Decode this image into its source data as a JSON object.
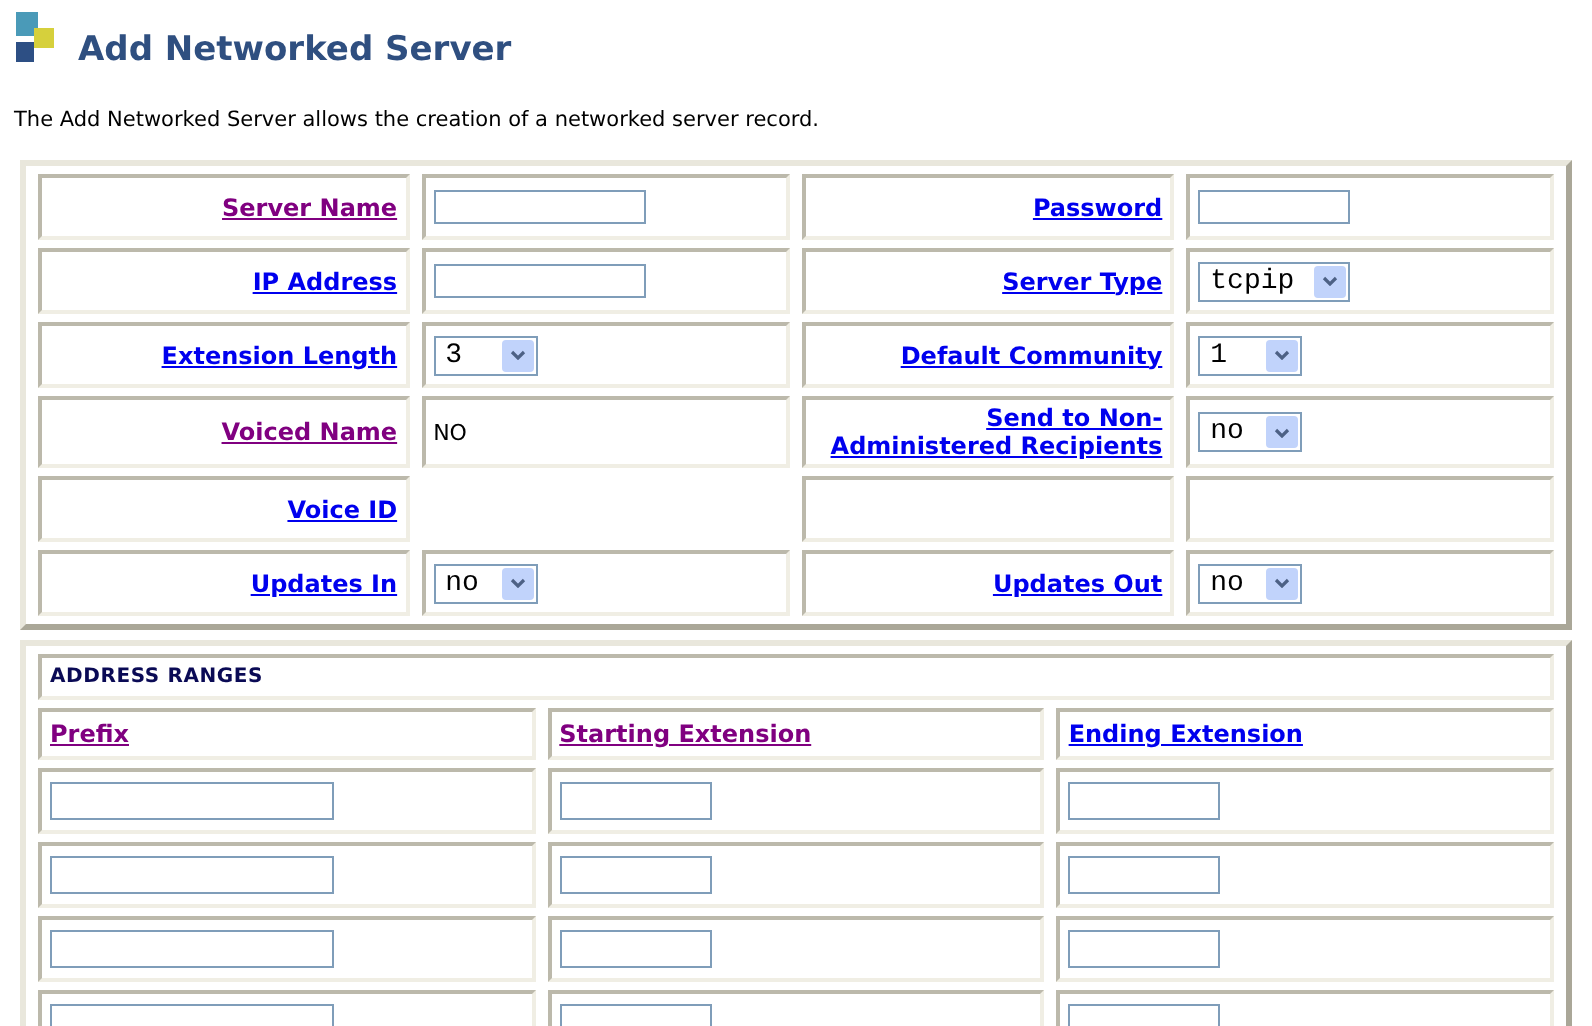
{
  "page": {
    "title": "Add Networked Server",
    "description": "The Add Networked Server allows the creation of a networked server record."
  },
  "server_form": {
    "rows": [
      {
        "left": {
          "label": {
            "text": "Server Name",
            "visited": true
          },
          "control": {
            "kind": "text"
          }
        },
        "right": {
          "label": {
            "text": "Password",
            "visited": false
          },
          "control": {
            "kind": "text"
          }
        }
      },
      {
        "left": {
          "label": {
            "text": "IP Address",
            "visited": false
          },
          "control": {
            "kind": "text"
          }
        },
        "right": {
          "label": {
            "text": "Server Type",
            "visited": false
          },
          "control": {
            "kind": "select",
            "value": "tcpip"
          }
        }
      },
      {
        "left": {
          "label": {
            "text": "Extension Length",
            "visited": false
          },
          "control": {
            "kind": "select",
            "value": "3"
          }
        },
        "right": {
          "label": {
            "text": "Default Community",
            "visited": false
          },
          "control": {
            "kind": "select",
            "value": "1"
          }
        }
      },
      {
        "left": {
          "label": {
            "text": "Voiced Name",
            "visited": true
          },
          "control": {
            "kind": "static",
            "value": "NO"
          }
        },
        "right": {
          "label": {
            "text": "Send to Non-Administered Recipients",
            "visited": false
          },
          "control": {
            "kind": "select",
            "value": "no"
          }
        }
      },
      {
        "left": {
          "label": {
            "text": "Voice ID",
            "visited": false
          },
          "control": {
            "kind": "none"
          }
        },
        "right": {
          "control": {
            "kind": "empty"
          }
        }
      },
      {
        "left": {
          "label": {
            "text": "Updates In",
            "visited": false
          },
          "control": {
            "kind": "select",
            "value": "no"
          }
        },
        "right": {
          "label": {
            "text": "Updates Out",
            "visited": false
          },
          "control": {
            "kind": "select",
            "value": "no"
          }
        }
      }
    ]
  },
  "address_ranges": {
    "title": "ADDRESS RANGES",
    "columns": [
      {
        "text": "Prefix",
        "visited": true
      },
      {
        "text": "Starting Extension",
        "visited": true
      },
      {
        "text": "Ending Extension",
        "visited": false
      }
    ],
    "rows": [
      [
        {
          "kind": "text"
        },
        {
          "kind": "text"
        },
        {
          "kind": "text"
        }
      ],
      [
        {
          "kind": "text"
        },
        {
          "kind": "text"
        },
        {
          "kind": "text"
        }
      ],
      [
        {
          "kind": "text"
        },
        {
          "kind": "text"
        },
        {
          "kind": "text"
        }
      ],
      [
        {
          "kind": "text"
        },
        {
          "kind": "text"
        },
        {
          "kind": "text"
        }
      ]
    ]
  }
}
